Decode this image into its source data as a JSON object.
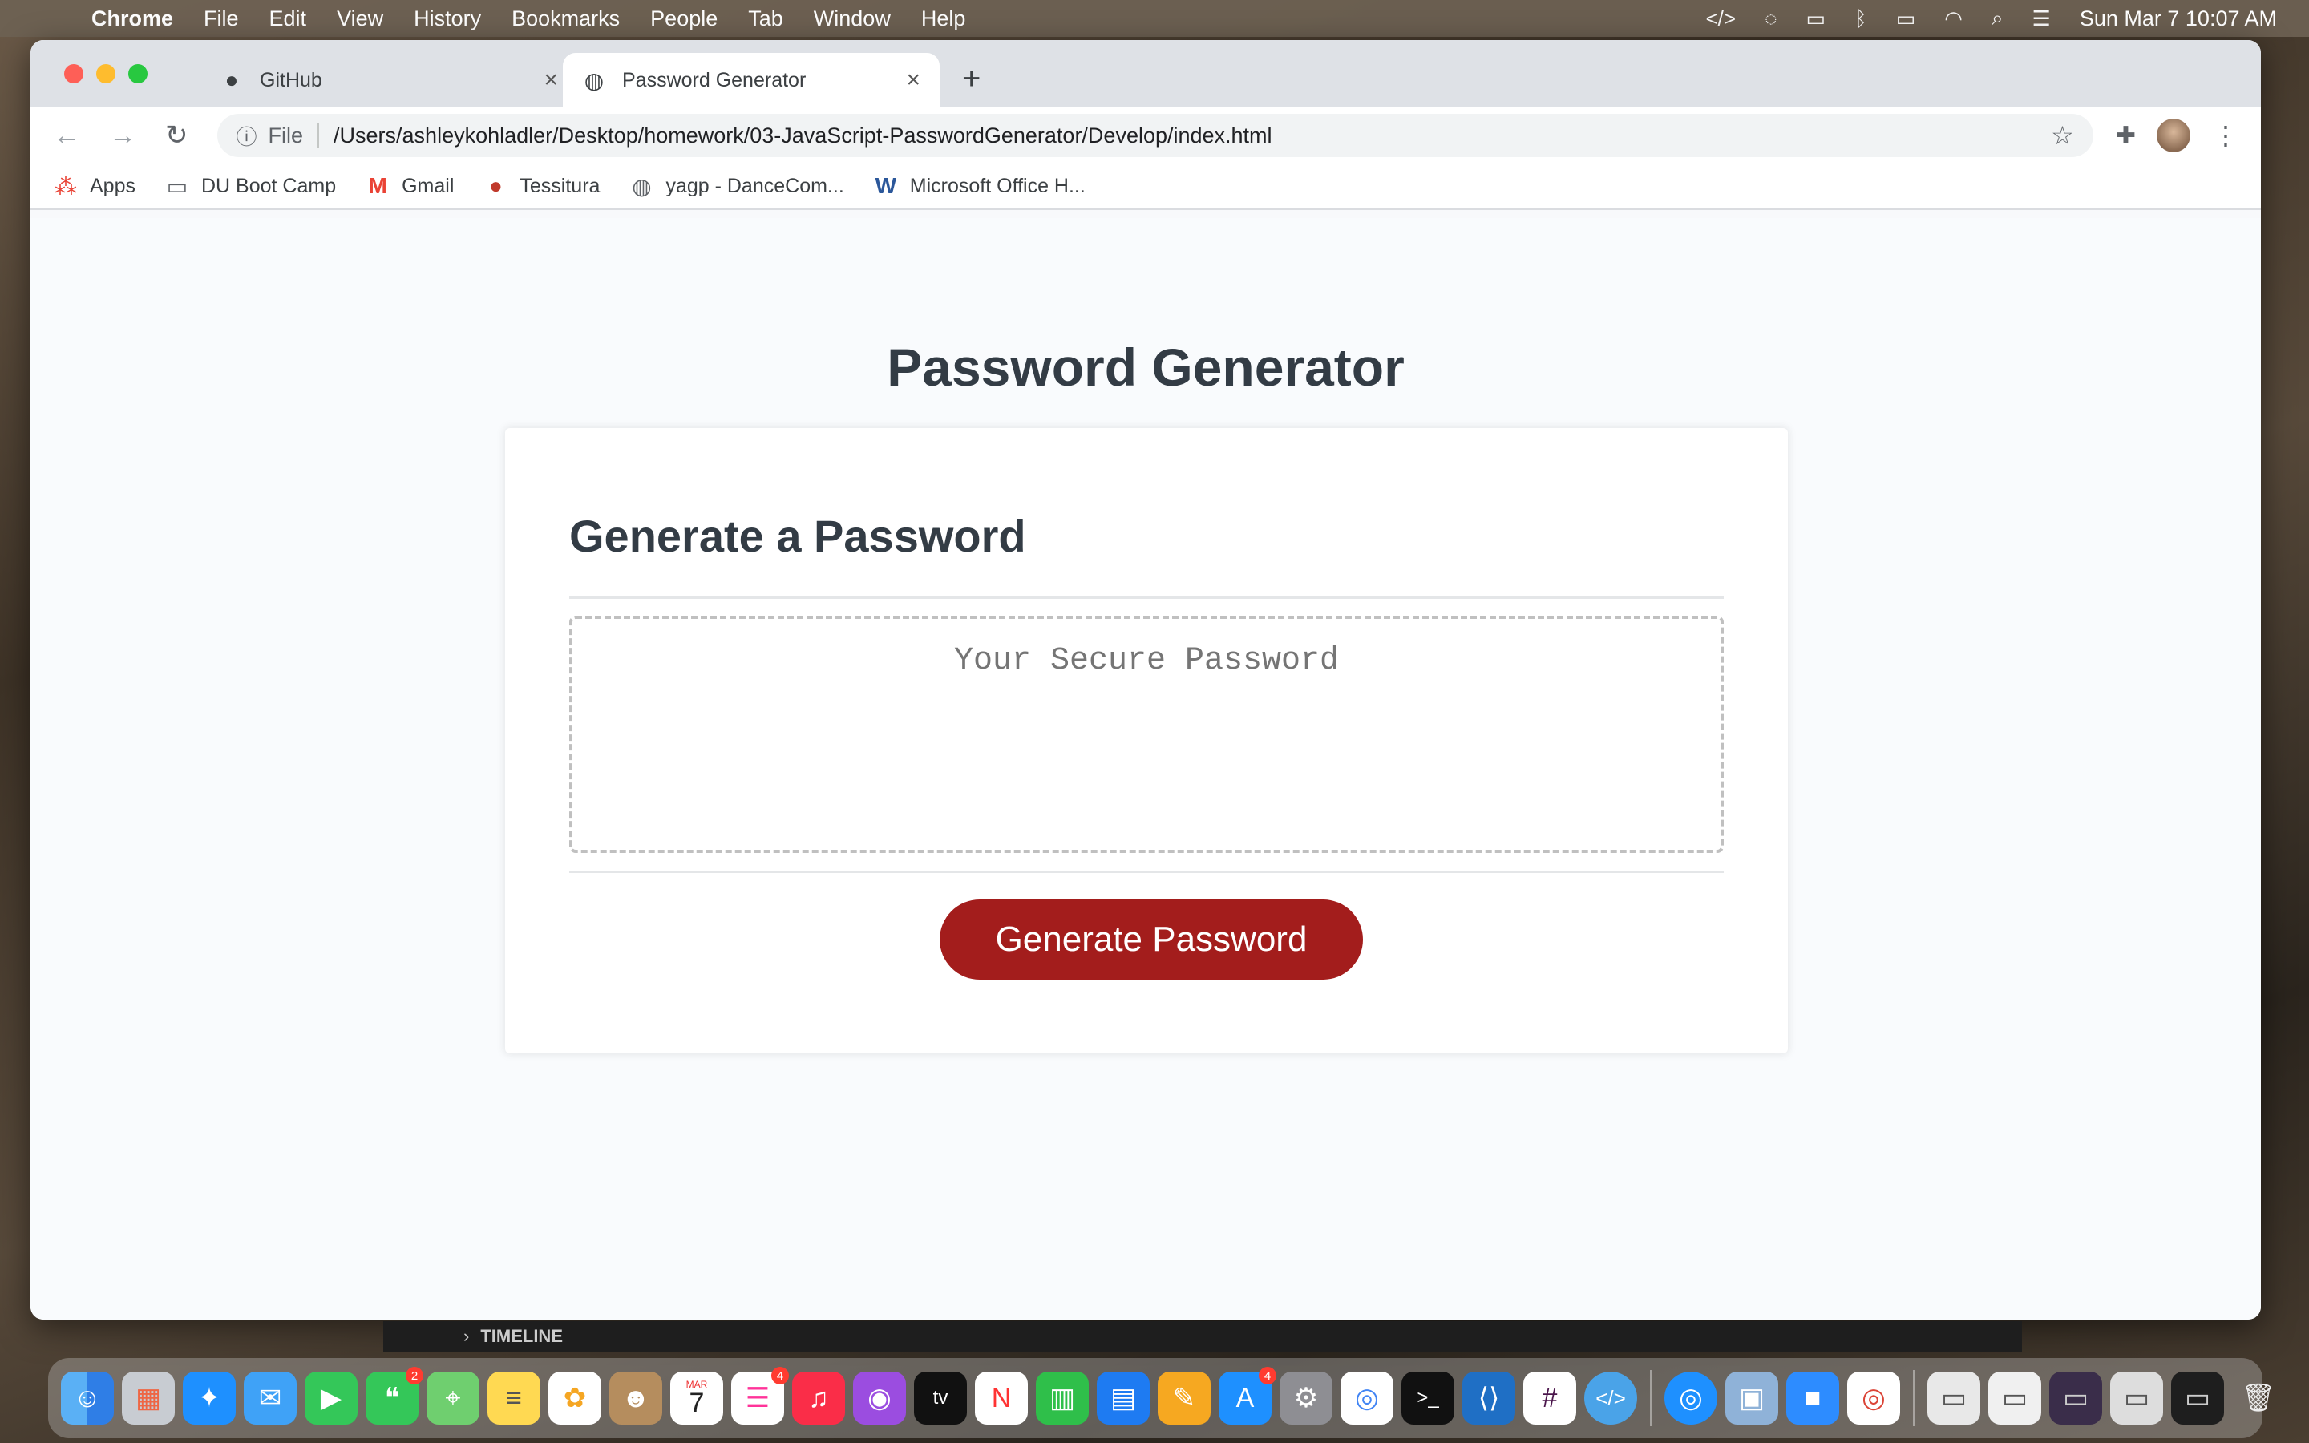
{
  "menubar": {
    "app": "Chrome",
    "items": [
      "File",
      "Edit",
      "View",
      "History",
      "Bookmarks",
      "People",
      "Tab",
      "Window",
      "Help"
    ],
    "clock": "Sun Mar 7  10:07 AM",
    "status_icons": [
      "dev-icon",
      "sync-icon",
      "display-icon",
      "bluetooth-icon",
      "battery-icon",
      "wifi-icon",
      "search-icon",
      "control-center-icon"
    ]
  },
  "browser": {
    "tabs": [
      {
        "title": "GitHub",
        "icon": "github-icon"
      },
      {
        "title": "Password Generator",
        "icon": "globe-icon"
      }
    ],
    "url_scheme": "File",
    "url": "/Users/ashleykohladler/Desktop/homework/03-JavaScript-PasswordGenerator/Develop/index.html",
    "bookmarks": [
      {
        "label": "Apps",
        "icon": "apps-grid-icon"
      },
      {
        "label": "DU Boot Camp",
        "icon": "folder-icon"
      },
      {
        "label": "Gmail",
        "icon": "gmail-icon"
      },
      {
        "label": "Tessitura",
        "icon": "tessitura-icon"
      },
      {
        "label": "yagp - DanceCom...",
        "icon": "globe-icon"
      },
      {
        "label": "Microsoft Office H...",
        "icon": "word-icon"
      }
    ]
  },
  "page": {
    "title": "Password Generator",
    "card_title": "Generate a Password",
    "password_placeholder": "Your Secure Password",
    "password_value": "",
    "button_label": "Generate Password",
    "button_color": "#a31d1c"
  },
  "background": {
    "timeline_label": "TIMELINE"
  },
  "dock": {
    "badges": {
      "messages": "2",
      "reminders": "4",
      "app_store": "4"
    },
    "calendar_month": "MAR",
    "calendar_day": "7"
  }
}
